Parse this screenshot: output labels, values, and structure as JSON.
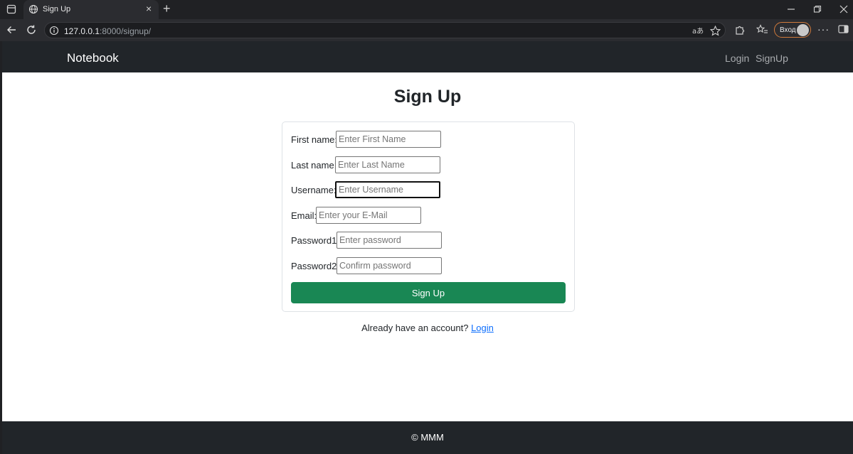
{
  "browser": {
    "tab_title": "Sign Up",
    "tab_close": "×",
    "new_tab": "+",
    "url_host": "127.0.0.1",
    "url_rest": ":8000/signup/",
    "profile_label": "Вход",
    "menu": "···"
  },
  "navbar": {
    "brand": "Notebook",
    "links": [
      "Login",
      "SignUp"
    ]
  },
  "page_title": "Sign Up",
  "form": {
    "fields": [
      {
        "label": "First name:",
        "placeholder": "Enter First Name"
      },
      {
        "label": "Last name:",
        "placeholder": "Enter Last Name"
      },
      {
        "label": "Username:",
        "placeholder": "Enter Username"
      },
      {
        "label": "Email:",
        "placeholder": "Enter your E-Mail"
      },
      {
        "label": "Password1:",
        "placeholder": "Enter password"
      },
      {
        "label": "Password2:",
        "placeholder": "Confirm password"
      }
    ],
    "submit_label": "Sign Up"
  },
  "footer_prompt": {
    "text": "Already have an account?",
    "link": "Login"
  },
  "footer": {
    "copyright": "© MMM"
  },
  "colors": {
    "navbar_bg": "#212529",
    "submit_bg": "#198754",
    "link": "#0d6efd"
  }
}
